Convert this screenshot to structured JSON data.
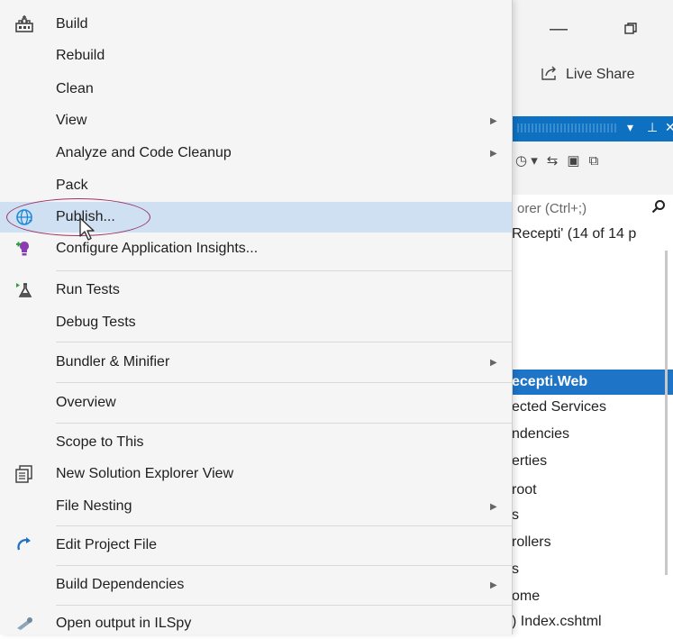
{
  "window": {
    "minimize_icon": "minimize-icon",
    "restore_icon": "restore-icon",
    "live_share_label": "Live Share"
  },
  "solution_explorer": {
    "search_placeholder": "orer (Ctrl+;)",
    "tree": [
      "Recepti' (14 of 14 p",
      "ecepti.Web",
      "ected Services",
      "ndencies",
      "erties",
      "root",
      "s",
      "rollers",
      "s",
      "ome",
      ") Index.cshtml"
    ]
  },
  "menu": {
    "items": [
      {
        "label": "Build",
        "icon": "build-icon"
      },
      {
        "label": "Rebuild"
      },
      {
        "label": "Clean"
      },
      {
        "label": "View",
        "submenu": true
      },
      {
        "label": "Analyze and Code Cleanup",
        "submenu": true
      },
      {
        "label": "Pack"
      },
      {
        "label": "Publish...",
        "icon": "publish-globe-icon",
        "highlighted": true
      },
      {
        "label": "Configure Application Insights...",
        "icon": "app-insights-icon"
      },
      {
        "label": "Run Tests",
        "icon": "run-tests-icon"
      },
      {
        "label": "Debug Tests"
      },
      {
        "label": "Bundler & Minifier",
        "submenu": true
      },
      {
        "label": "Overview"
      },
      {
        "label": "Scope to This"
      },
      {
        "label": "New Solution Explorer View",
        "icon": "new-explorer-view-icon"
      },
      {
        "label": "File Nesting",
        "submenu": true
      },
      {
        "label": "Edit Project File",
        "icon": "edit-project-icon"
      },
      {
        "label": "Build Dependencies",
        "submenu": true
      },
      {
        "label": "Open output in ILSpy",
        "icon": "ilspy-icon"
      }
    ]
  },
  "colors": {
    "menu_bg": "#f5f5f5",
    "highlight": "#cfe0f3",
    "accent_blue": "#0e70c0",
    "annotation_circle": "#9a3566"
  }
}
